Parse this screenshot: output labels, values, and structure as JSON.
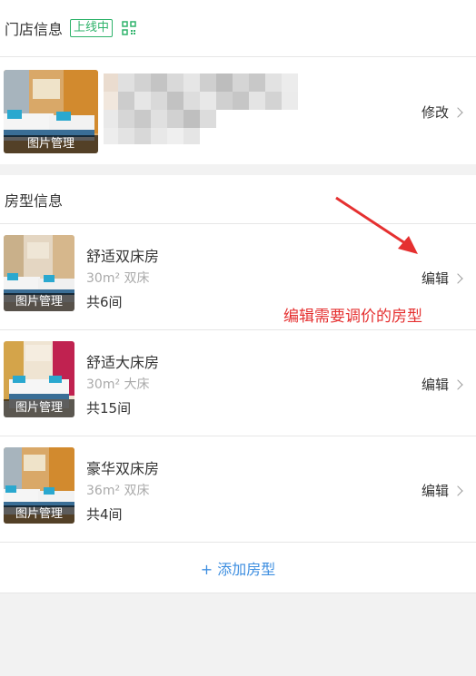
{
  "store": {
    "title": "门店信息",
    "status_badge": "上线中",
    "photo_caption": "图片管理",
    "modify_label": "修改"
  },
  "rooms_section": {
    "title": "房型信息",
    "edit_label": "编辑",
    "photo_caption": "图片管理",
    "items": [
      {
        "name": "舒适双床房",
        "spec": "30m² 双床",
        "count": "共6间"
      },
      {
        "name": "舒适大床房",
        "spec": "30m² 大床",
        "count": "共15间"
      },
      {
        "name": "豪华双床房",
        "spec": "36m² 双床",
        "count": "共4间"
      }
    ]
  },
  "annotation": {
    "text": "编辑需要调价的房型",
    "color": "#e53030"
  },
  "add_room": {
    "label": "+ 添加房型"
  },
  "colors": {
    "accent_green": "#2fb36b",
    "link_blue": "#3d8ee0",
    "background": "#f2f2f2"
  }
}
